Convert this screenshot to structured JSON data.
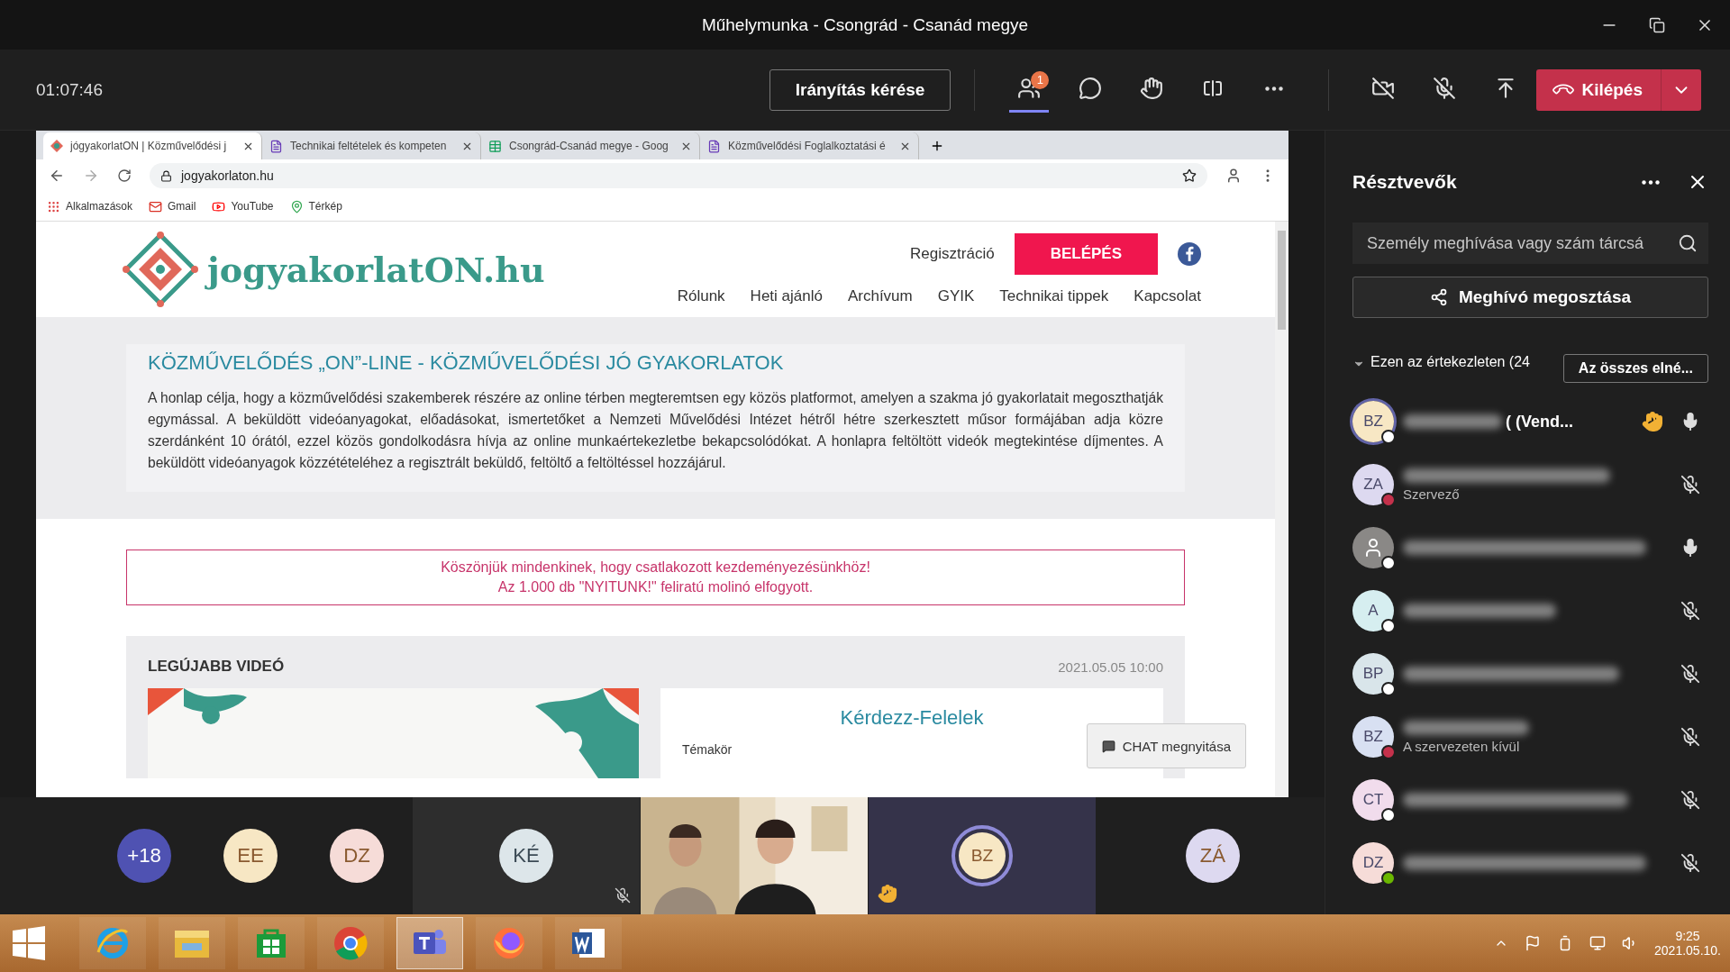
{
  "window": {
    "title": "Műhelymunka - Csongrád - Csanád megye"
  },
  "toolbar": {
    "timer": "01:07:46",
    "control_button": "Irányítás kérése",
    "people_badge": "1",
    "leave_button": "Kilépés"
  },
  "browser": {
    "tabs": [
      {
        "title": "jógyakorlatON | Közművelődési j",
        "selected": true
      },
      {
        "title": "Technikai feltételek és kompeten",
        "selected": false
      },
      {
        "title": "Csongrád-Csanád megye - Goog",
        "selected": false
      },
      {
        "title": "Közművelődési Foglalkoztatási é",
        "selected": false
      }
    ],
    "url": "jogyakorlaton.hu",
    "bookmarks": [
      "Alkalmazások",
      "Gmail",
      "YouTube",
      "Térkép"
    ]
  },
  "site": {
    "logo": "jogyakorlatON.hu",
    "register": "Regisztráció",
    "login": "BELÉPÉS",
    "nav": [
      "Rólunk",
      "Heti ajánló",
      "Archívum",
      "GYIK",
      "Technikai tippek",
      "Kapcsolat"
    ],
    "heading": "KÖZMŰVELŐDÉS „ON”-LINE - KÖZMŰVELŐDÉSI JÓ GYAKORLATOK",
    "intro": "A honlap célja, hogy a közművelődési szakemberek részére az online térben megteremtsen egy közös platformot, amelyen a szakma jó gyakorlatait megoszthatják egymással. A beküldött videóanyagokat, előadásokat, ismertetőket a Nemzeti Művelődési Intézet hétről hétre szerkesztett műsor formájában adja közre szerdánként 10 órától, ezzel közös gondolkodásra hívja az online munkaértekezletbe bekapcsolódókat. A honlapra feltöltött videók megtekintése díjmentes. A beküldött videóanyagok közzétételéhez a regisztrált beküldő, feltöltő a feltöltéssel hozzájárul.",
    "notice": [
      "Köszönjük mindenkinek, hogy csatlakozott kezdeményezésünkhöz!",
      "Az 1.000 db \"NYITUNK!\" feliratú molinó elfogyott."
    ],
    "latest": {
      "title": "LEGÚJABB VIDEÓ",
      "date": "2021.05.05 10:00",
      "video_title": "Kérdezz-Felelek",
      "topic_label": "Témakör"
    },
    "chat_button": "CHAT megnyitása"
  },
  "strip": [
    {
      "kind": "count",
      "label": "+18"
    },
    {
      "kind": "avatar",
      "initials": "EE",
      "color": "#f7e7c4"
    },
    {
      "kind": "avatar",
      "initials": "DZ",
      "color": "#f6dcd8"
    },
    {
      "kind": "tile",
      "initials": "KÉ",
      "color": "#dde6ea",
      "muted": true,
      "hand": false,
      "speaking": false
    },
    {
      "kind": "video"
    },
    {
      "kind": "tile",
      "initials": "BZ",
      "color": "#f7e7c4",
      "muted": false,
      "hand": true,
      "speaking": true
    },
    {
      "kind": "avatar",
      "initials": "ZÁ",
      "color": "#ddd9f0"
    }
  ],
  "participants": {
    "title": "Résztvevők",
    "search_placeholder": "Személy meghívása vagy szám tárcsá",
    "share_button": "Meghívó megosztása",
    "section": "Ezen az értekezleten (24",
    "mute_all": "Az összes elné...",
    "items": [
      {
        "kind": "initials",
        "initials": "BZ",
        "color": "#ffffff",
        "speaking": true,
        "hand": true,
        "muted": false,
        "name_tail": "( (Vend..."
      },
      {
        "kind": "initials",
        "initials": "ZA",
        "color": "#c4314b",
        "speaking": false,
        "hand": false,
        "muted": true,
        "subtitle": "Szervező"
      },
      {
        "kind": "person",
        "color": "#ffffff",
        "speaking": false,
        "hand": false,
        "muted": false
      },
      {
        "kind": "initials",
        "initials": "A",
        "color": "#ffffff",
        "speaking": false,
        "hand": false,
        "muted": true
      },
      {
        "kind": "initials",
        "initials": "BP",
        "color": "#ffffff",
        "speaking": false,
        "hand": false,
        "muted": true
      },
      {
        "kind": "initials",
        "initials": "BZ",
        "color": "#c4314b",
        "speaking": false,
        "hand": false,
        "muted": true,
        "subtitle": "A szervezeten kívül"
      },
      {
        "kind": "initials",
        "initials": "CT",
        "color": "#ffffff",
        "speaking": false,
        "hand": false,
        "muted": true
      },
      {
        "kind": "initials",
        "initials": "DZ",
        "color": "#6bb700",
        "speaking": false,
        "hand": false,
        "muted": true
      }
    ]
  },
  "taskbar": {
    "apps": [
      {
        "selected": false
      },
      {
        "selected": false
      },
      {
        "selected": false
      },
      {
        "selected": false
      },
      {
        "selected": true
      },
      {
        "selected": false
      },
      {
        "selected": false
      }
    ],
    "time": "9:25",
    "date": "2021.05.10."
  }
}
